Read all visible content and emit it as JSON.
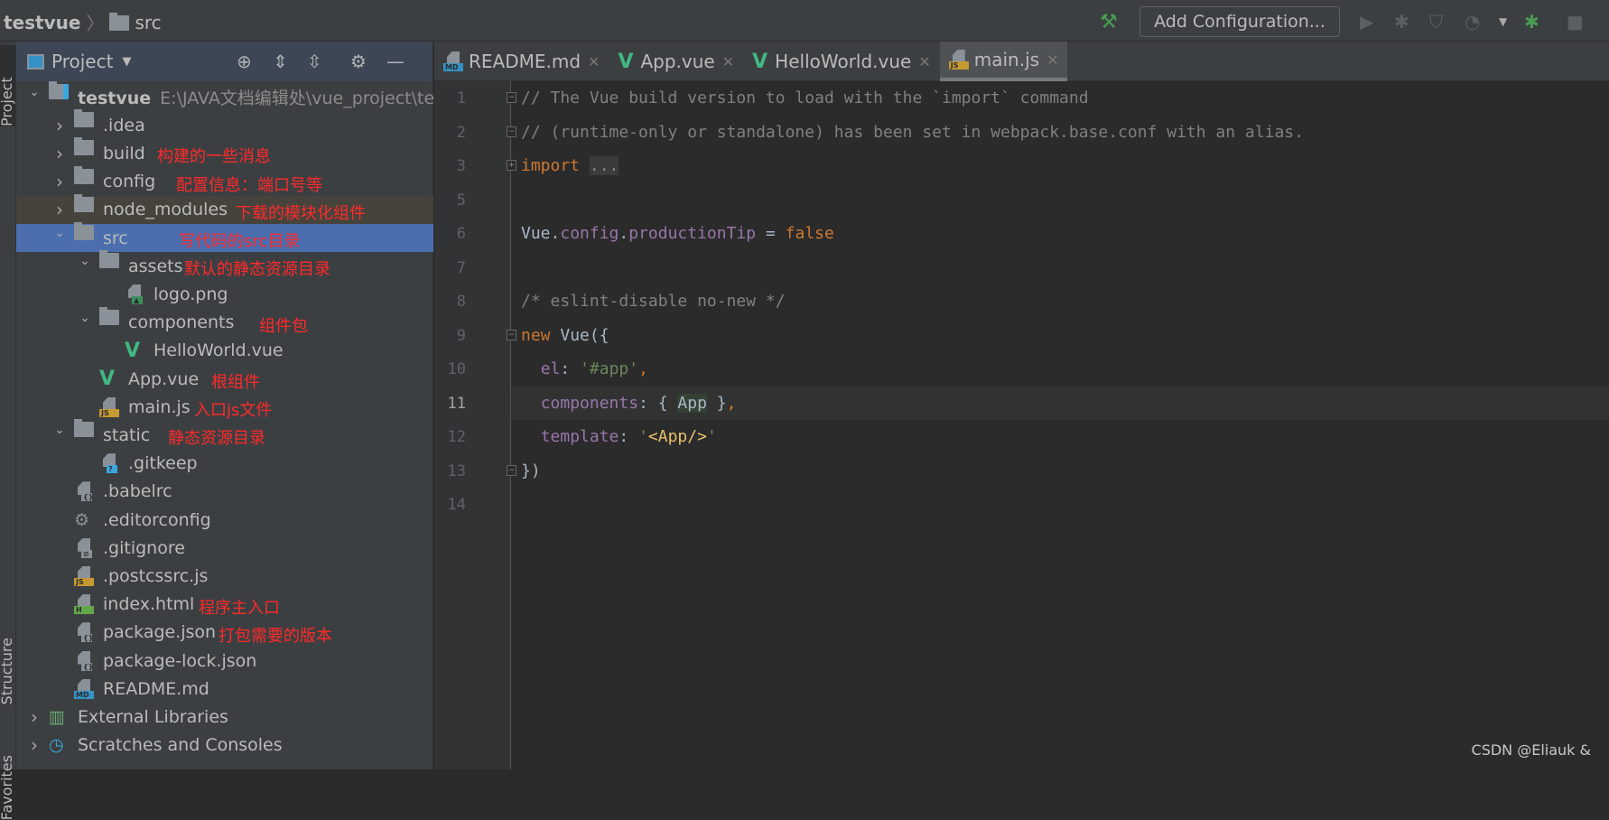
{
  "breadcrumb": {
    "root": "testvue",
    "child": "src"
  },
  "toolbar": {
    "add_configuration": "Add Configuration..."
  },
  "side_tabs": {
    "project": "Project",
    "structure": "Structure",
    "favorites": "Favorites"
  },
  "project_panel": {
    "title": "Project"
  },
  "tree": [
    {
      "level": 0,
      "expand": "open",
      "icon": "project",
      "label": "testvue",
      "bold": true,
      "path": "E:\\JAVA文档编辑处\\vue_project\\te"
    },
    {
      "level": 1,
      "expand": "closed",
      "icon": "folder",
      "label": ".idea"
    },
    {
      "level": 1,
      "expand": "closed",
      "icon": "folder",
      "label": "build",
      "note": "构建的一些消息"
    },
    {
      "level": 1,
      "expand": "closed",
      "icon": "folder",
      "label": "config",
      "note": "配置信息：端口号等"
    },
    {
      "level": 1,
      "expand": "closed",
      "icon": "folder",
      "label": "node_modules",
      "note": "下载的模块化组件",
      "excluded": true
    },
    {
      "level": 1,
      "expand": "open",
      "icon": "folder",
      "label": "src",
      "note": "写代码的src目录",
      "selected": true
    },
    {
      "level": 2,
      "expand": "open",
      "icon": "folder",
      "label": "assets",
      "note": "默认的静态资源目录"
    },
    {
      "level": 3,
      "icon": "image",
      "label": "logo.png"
    },
    {
      "level": 2,
      "expand": "open",
      "icon": "folder",
      "label": "components",
      "note": "组件包"
    },
    {
      "level": 3,
      "icon": "vue",
      "label": "HelloWorld.vue"
    },
    {
      "level": 2,
      "icon": "vue",
      "label": "App.vue",
      "note": "根组件"
    },
    {
      "level": 2,
      "icon": "js",
      "label": "main.js",
      "note": "入口js文件"
    },
    {
      "level": 1,
      "expand": "open",
      "icon": "folder",
      "label": "static",
      "note": "静态资源目录"
    },
    {
      "level": 2,
      "icon": "unknown",
      "label": ".gitkeep"
    },
    {
      "level": 1,
      "icon": "json",
      "label": ".babelrc"
    },
    {
      "level": 1,
      "icon": "gear",
      "label": ".editorconfig"
    },
    {
      "level": 1,
      "icon": "ignore",
      "label": ".gitignore"
    },
    {
      "level": 1,
      "icon": "js",
      "label": ".postcssrc.js"
    },
    {
      "level": 1,
      "icon": "html",
      "label": "index.html",
      "note": "程序主入口"
    },
    {
      "level": 1,
      "icon": "json",
      "label": "package.json",
      "note": "打包需要的版本"
    },
    {
      "level": 1,
      "icon": "json",
      "label": "package-lock.json"
    },
    {
      "level": 1,
      "icon": "md",
      "label": "README.md"
    },
    {
      "level": 0,
      "expand": "closed",
      "icon": "library",
      "label": "External Libraries"
    },
    {
      "level": 0,
      "expand": "closed",
      "icon": "scratch",
      "label": "Scratches and Consoles"
    }
  ],
  "tabs": [
    {
      "label": "README.md",
      "icon": "md"
    },
    {
      "label": "App.vue",
      "icon": "vue"
    },
    {
      "label": "HelloWorld.vue",
      "icon": "vue"
    },
    {
      "label": "main.js",
      "icon": "js",
      "active": true
    }
  ],
  "code": [
    {
      "n": "1",
      "fold": "-",
      "tokens": [
        [
          "// The Vue build version to load with the `import` command",
          "c"
        ]
      ]
    },
    {
      "n": "2",
      "fold": "-",
      "tokens": [
        [
          "// (runtime-only or standalone) has been set in webpack.base.conf with an alias.",
          "c"
        ]
      ]
    },
    {
      "n": "3",
      "fold": "+",
      "tokens": [
        [
          "import",
          "k"
        ],
        [
          " ",
          ""
        ],
        [
          "...",
          "f"
        ]
      ]
    },
    {
      "n": "5",
      "tokens": []
    },
    {
      "n": "6",
      "tokens": [
        [
          "Vue",
          ""
        ],
        [
          ".",
          ""
        ],
        [
          "config",
          "p"
        ],
        [
          ".",
          ""
        ],
        [
          "productionTip",
          "p"
        ],
        [
          " = ",
          ""
        ],
        [
          "false",
          "k"
        ]
      ]
    },
    {
      "n": "7",
      "tokens": []
    },
    {
      "n": "8",
      "tokens": [
        [
          "/* eslint-disable no-new */",
          "c"
        ]
      ]
    },
    {
      "n": "9",
      "fold": "-",
      "tokens": [
        [
          "new",
          "k"
        ],
        [
          " Vue({",
          ""
        ]
      ]
    },
    {
      "n": "10",
      "tokens": [
        [
          "  ",
          ""
        ],
        [
          "el",
          "p"
        ],
        [
          ": ",
          ""
        ],
        [
          "'#app'",
          "s"
        ],
        [
          ",",
          "k"
        ]
      ]
    },
    {
      "n": "11",
      "current": true,
      "tokens": [
        [
          "  ",
          ""
        ],
        [
          "components",
          "p"
        ],
        [
          ": { ",
          ""
        ],
        [
          "App",
          "h"
        ],
        [
          " }",
          ""
        ],
        [
          ",",
          "k"
        ]
      ]
    },
    {
      "n": "12",
      "tokens": [
        [
          "  ",
          ""
        ],
        [
          "template",
          "p"
        ],
        [
          ": ",
          ""
        ],
        [
          "'",
          "s"
        ],
        [
          "<App/>",
          "t"
        ],
        [
          "'",
          "s"
        ]
      ]
    },
    {
      "n": "13",
      "fold": "-",
      "tokens": [
        [
          "})",
          ""
        ]
      ]
    },
    {
      "n": "14",
      "tokens": []
    }
  ],
  "watermark": "CSDN @Eliauk  &"
}
